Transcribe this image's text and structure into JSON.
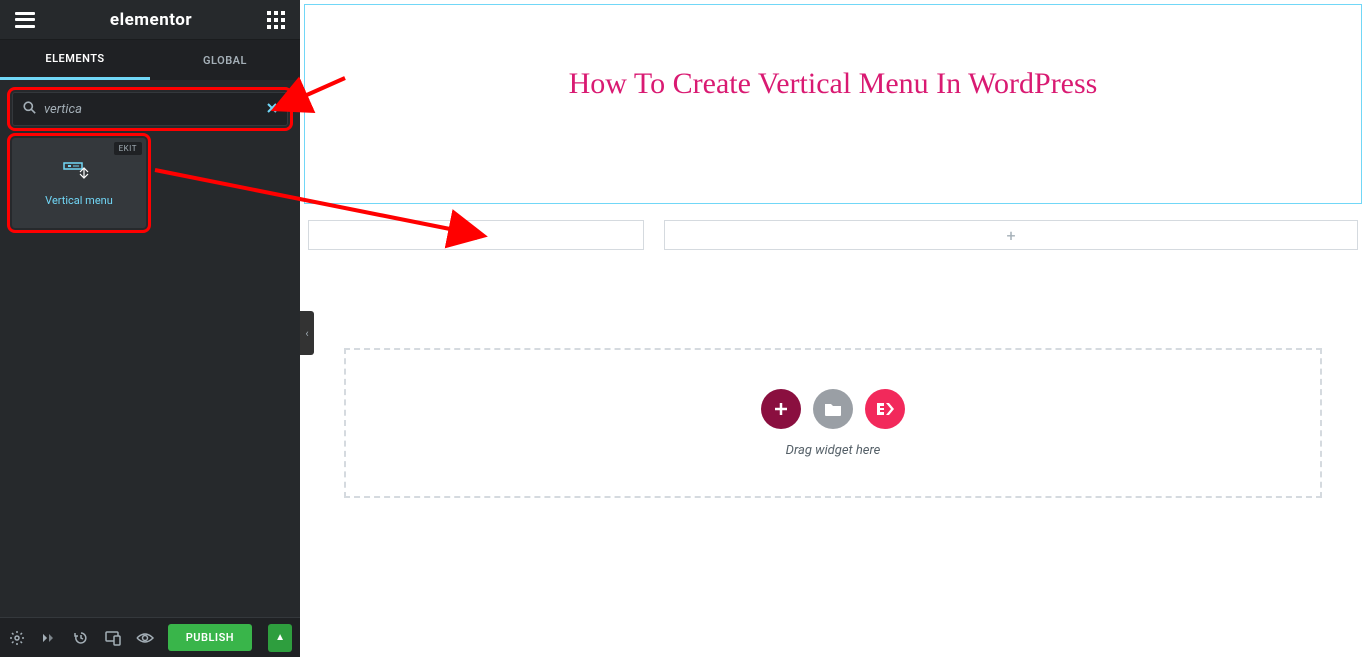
{
  "sidebar": {
    "brand": "elementor",
    "tabs": {
      "elements": "ELEMENTS",
      "global": "GLOBAL"
    },
    "search_value": "vertica",
    "widget": {
      "badge": "EKIT",
      "label": "Vertical menu"
    },
    "publish": "PUBLISH"
  },
  "canvas": {
    "title": "How To Create Vertical Menu In WordPress",
    "drag_hint": "Drag widget here"
  }
}
